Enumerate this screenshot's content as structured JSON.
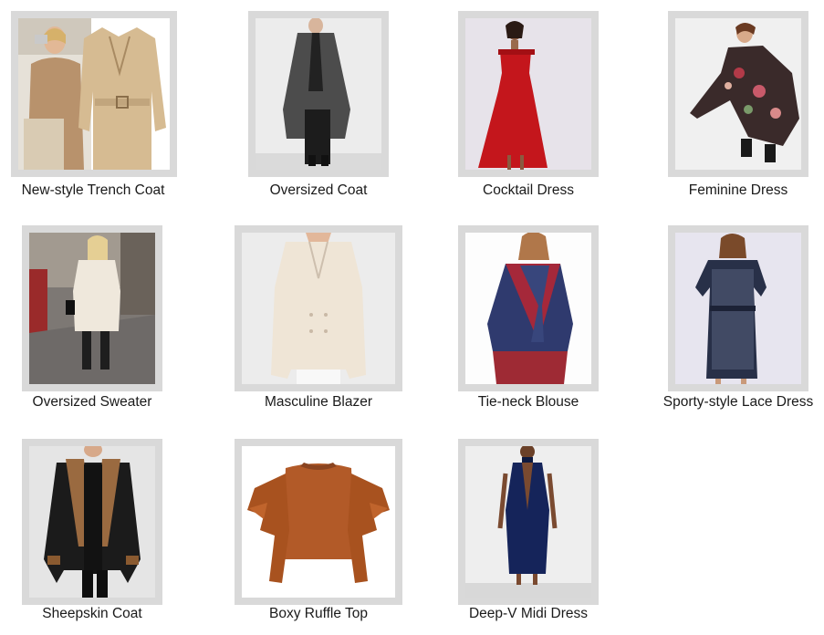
{
  "gallery": {
    "items": [
      {
        "caption": "New-style Trench Coat"
      },
      {
        "caption": "Oversized Coat"
      },
      {
        "caption": "Cocktail Dress"
      },
      {
        "caption": "Feminine Dress"
      },
      {
        "caption": "Oversized Sweater"
      },
      {
        "caption": "Masculine Blazer"
      },
      {
        "caption": "Tie-neck Blouse"
      },
      {
        "caption": "Sporty-style Lace Dress"
      },
      {
        "caption": "Sheepskin Coat"
      },
      {
        "caption": "Boxy Ruffle Top"
      },
      {
        "caption": "Deep-V Midi Dress"
      }
    ]
  },
  "colors": {
    "frame": "#d9d9d9",
    "caption_text": "#1a1a1a"
  }
}
